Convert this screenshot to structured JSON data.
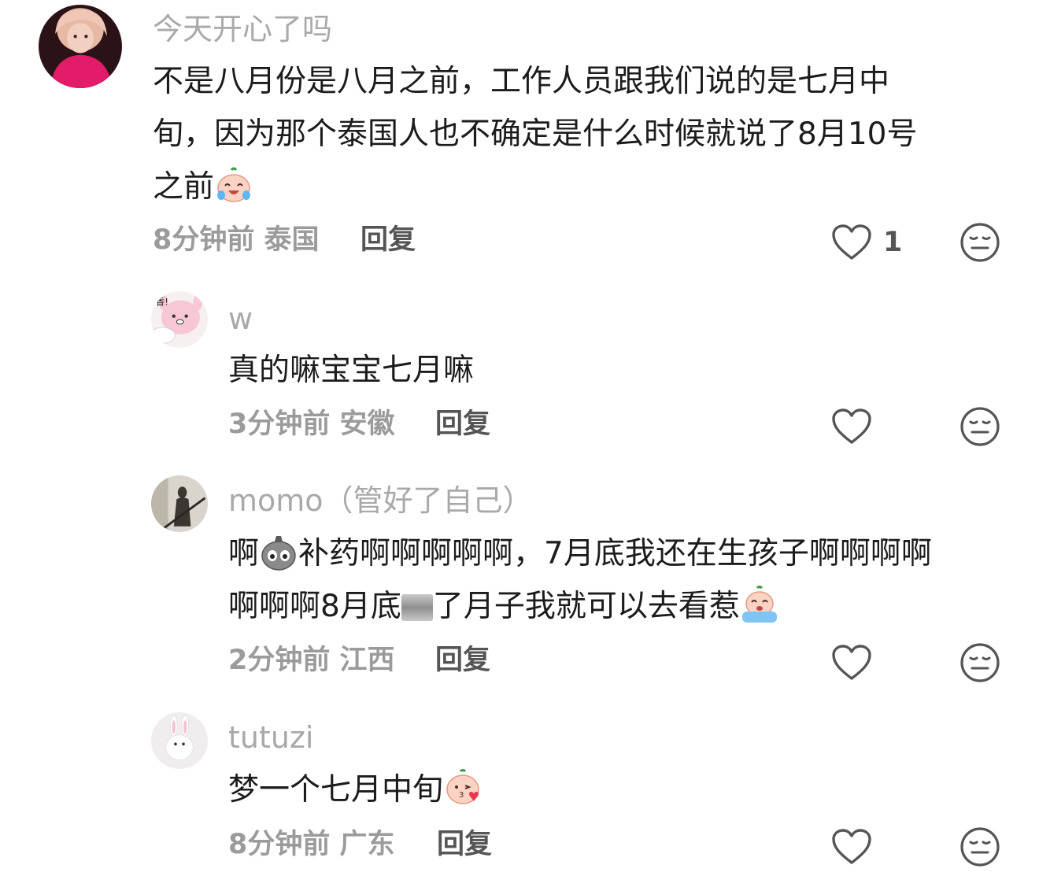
{
  "comments": [
    {
      "username": "今天开心了吗",
      "text_lines": [
        "不是八月份是八月之前，工作人员跟我们说的是七月中",
        "旬，因为那个泰国人也不确定是什么时候就说了8月10号",
        "之前"
      ],
      "time": "8分钟前",
      "location": "泰国",
      "reply_label": "回复",
      "like_count": "1",
      "trailing_emoji": "crying-laughing-emoji"
    },
    {
      "username": "w",
      "text_lines": [
        "真的嘛宝宝七月嘛"
      ],
      "time": "3分钟前",
      "location": "安徽",
      "reply_label": "回复",
      "like_count": ""
    },
    {
      "username": "momo（管好了自己）",
      "text_lines": [
        "啊",
        "补药啊啊啊啊啊，7月底我还在生孩子啊啊啊啊",
        "啊啊啊8月底",
        "了月子我就可以去看惹"
      ],
      "time": "2分钟前",
      "location": "江西",
      "reply_label": "回复",
      "like_count": ""
    },
    {
      "username": "tutuzi",
      "text_lines": [
        "梦一个七月中旬"
      ],
      "time": "8分钟前",
      "location": "广东",
      "reply_label": "回复",
      "like_count": ""
    }
  ],
  "icons": {
    "like": "heart-outline-icon",
    "dislike": "neutral-face-icon"
  }
}
